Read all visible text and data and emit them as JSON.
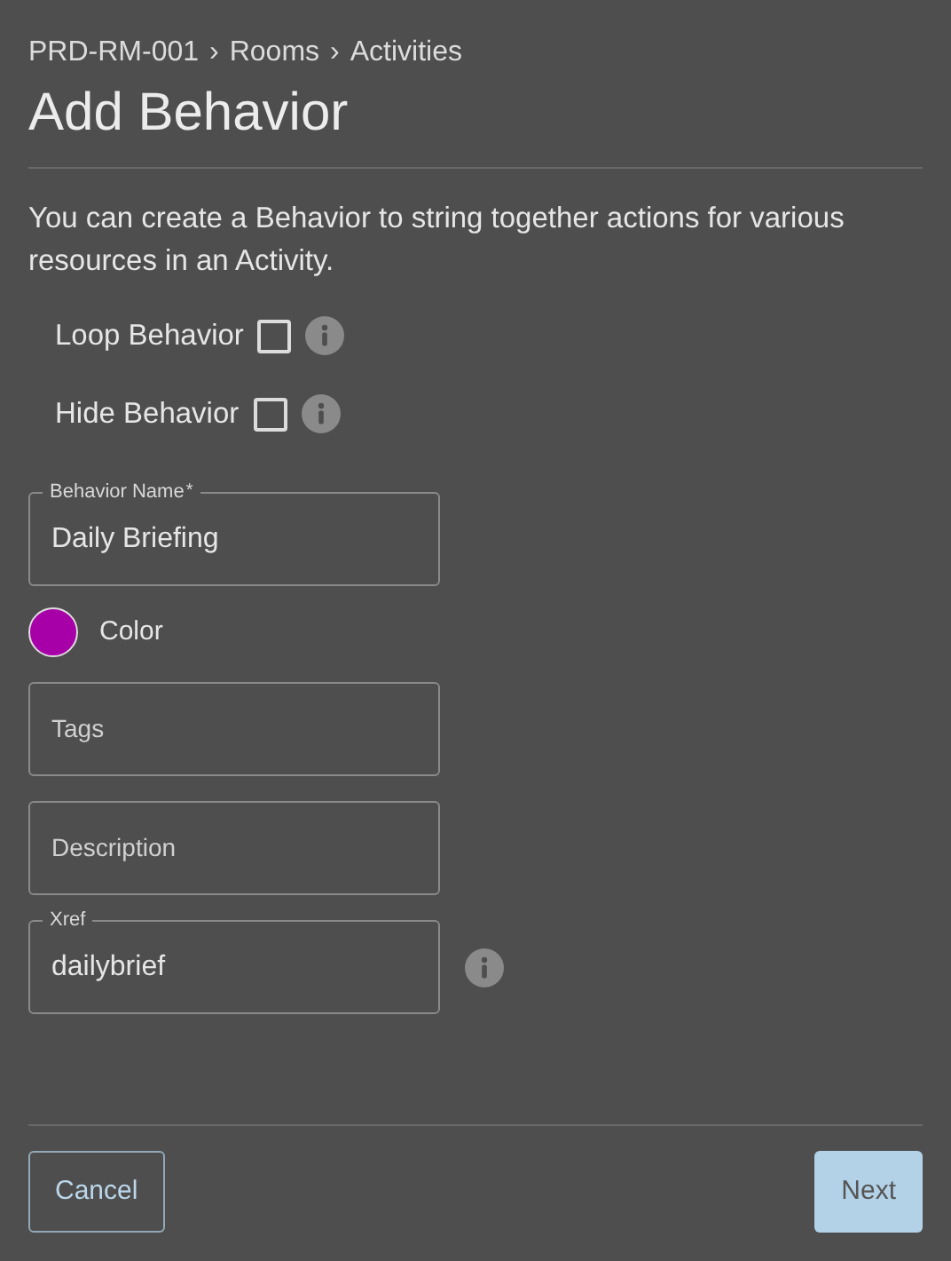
{
  "breadcrumb": [
    "PRD-RM-001",
    "Rooms",
    "Activities"
  ],
  "breadcrumb_separator": "›",
  "required_mark": "*",
  "title": "Add Behavior",
  "description": "You can create a Behavior to string together actions for various resources in an Activity.",
  "options": [
    {
      "label": "Loop Behavior",
      "checked": false,
      "info": true
    },
    {
      "label": "Hide Behavior",
      "checked": false,
      "info": true
    }
  ],
  "fields": [
    {
      "kind": "text",
      "label": "Behavior Name",
      "required": true,
      "value": "Daily Briefing",
      "info": false
    },
    {
      "kind": "color",
      "label": "Color",
      "color": "#a800a8"
    },
    {
      "kind": "text",
      "placeholder": "Tags",
      "info": false
    },
    {
      "kind": "text",
      "placeholder": "Description",
      "info": false
    },
    {
      "kind": "text",
      "label": "Xref",
      "required": false,
      "value": "dailybrief",
      "info": true
    }
  ],
  "buttons": [
    {
      "label": "Cancel",
      "kind": "outline",
      "disabled": false
    },
    {
      "label": "Next",
      "kind": "primary",
      "disabled": true
    }
  ]
}
